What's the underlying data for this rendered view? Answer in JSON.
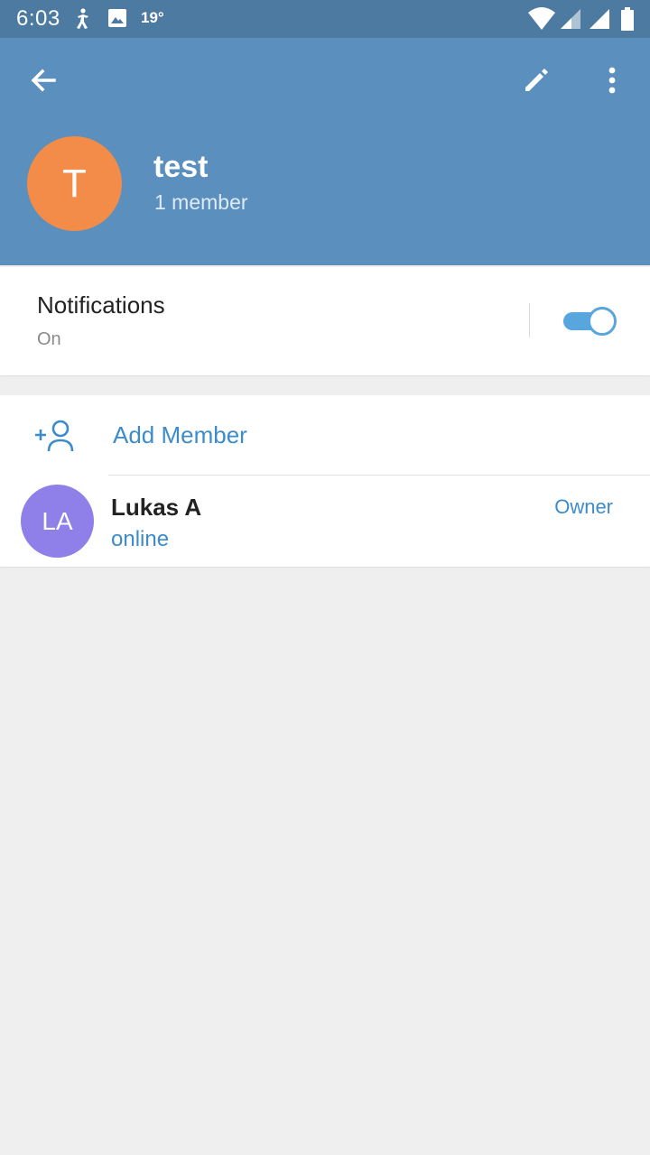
{
  "statusbar": {
    "time": "6:03",
    "temperature": "19°",
    "icons": [
      "accessibility-icon",
      "image-icon",
      "wifi-icon",
      "signal-icon",
      "signal-icon",
      "battery-icon"
    ]
  },
  "header": {
    "background": "#5b8fbe",
    "avatar_letter": "T",
    "avatar_color": "#f28c48",
    "title": "test",
    "subtitle": "1 member",
    "icons": [
      "back-arrow-icon",
      "edit-pencil-icon",
      "more-vert-icon"
    ]
  },
  "notifications": {
    "title": "Notifications",
    "status": "On",
    "toggle_on": true,
    "accent": "#57a6de"
  },
  "members": {
    "add_label": "Add Member",
    "add_icon": "add-person-icon",
    "list": [
      {
        "initials": "LA",
        "name": "Lukas A",
        "status": "online",
        "role": "Owner",
        "avatar_color": "#8f7fe8"
      }
    ]
  }
}
